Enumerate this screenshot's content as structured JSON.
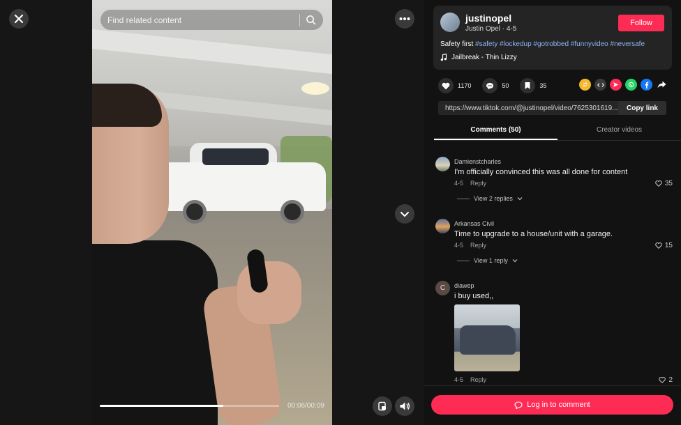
{
  "video": {
    "search_placeholder": "Find related content",
    "time": "00:06/00:09",
    "progress": 0.69
  },
  "author": {
    "username": "justinopel",
    "subline": "Justin Opel · 4-5",
    "follow_label": "Follow"
  },
  "caption": {
    "text": "Safety first ",
    "tags": [
      "#safety",
      "#lockedup",
      "#gotrobbed",
      "#funnyvideo",
      "#neversafe"
    ]
  },
  "music": "Jailbreak - Thin Lizzy",
  "stats": {
    "likes": "1170",
    "comments": "50",
    "saves": "35"
  },
  "link": {
    "url": "https://www.tiktok.com/@justinopel/video/7625301619...",
    "copy_label": "Copy link"
  },
  "tabs": [
    "Comments (50)",
    "Creator videos"
  ],
  "comments": [
    {
      "user": "Damienstcharles",
      "text": "I'm officially convinced this was all done for content",
      "date": "4-5",
      "reply_label": "Reply",
      "likes": "35",
      "replies": "View 2 replies"
    },
    {
      "user": "Arkansas Civil",
      "text": "Time to upgrade to a house/unit with a garage.",
      "date": "4-5",
      "reply_label": "Reply",
      "likes": "15",
      "replies": "View 1 reply"
    },
    {
      "user": "diawep",
      "avatar_letter": "C",
      "text": "i buy used,,",
      "date": "4-5",
      "reply_label": "Reply",
      "likes": "2"
    }
  ],
  "login_label": "Log in to comment",
  "colors": {
    "accent": "#fe2c55",
    "hashtag": "#8ab4f8"
  }
}
